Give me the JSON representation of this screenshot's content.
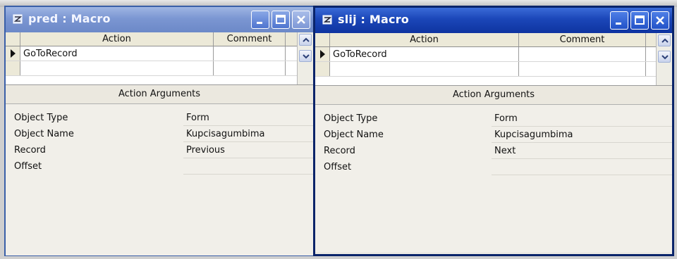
{
  "windows": [
    {
      "title": "pred : Macro",
      "grid": {
        "headers": {
          "action": "Action",
          "comment": "Comment"
        },
        "rows": [
          {
            "action": "GoToRecord",
            "comment": ""
          }
        ]
      },
      "args": {
        "title": "Action Arguments",
        "rows": [
          {
            "label": "Object Type",
            "value": "Form"
          },
          {
            "label": "Object Name",
            "value": "Kupcisagumbima"
          },
          {
            "label": "Record",
            "value": "Previous"
          },
          {
            "label": "Offset",
            "value": ""
          }
        ]
      }
    },
    {
      "title": "slij : Macro",
      "grid": {
        "headers": {
          "action": "Action",
          "comment": "Comment"
        },
        "rows": [
          {
            "action": "GoToRecord",
            "comment": ""
          }
        ]
      },
      "args": {
        "title": "Action Arguments",
        "rows": [
          {
            "label": "Object Type",
            "value": "Form"
          },
          {
            "label": "Object Name",
            "value": "Kupcisagumbima"
          },
          {
            "label": "Record",
            "value": "Next"
          },
          {
            "label": "Offset",
            "value": ""
          }
        ]
      }
    }
  ],
  "icons": {
    "window": "macro-icon",
    "minimize": "minimize-icon",
    "maximize": "maximize-icon",
    "close": "close-icon",
    "row_selector": "current-row-arrow-icon",
    "scroll_up": "arrow-up-icon",
    "scroll_down": "arrow-down-icon"
  },
  "colors": {
    "active_titlebar": "#1b46b8",
    "inactive_titlebar": "#7b96d2",
    "close_button": "#c44a22"
  }
}
